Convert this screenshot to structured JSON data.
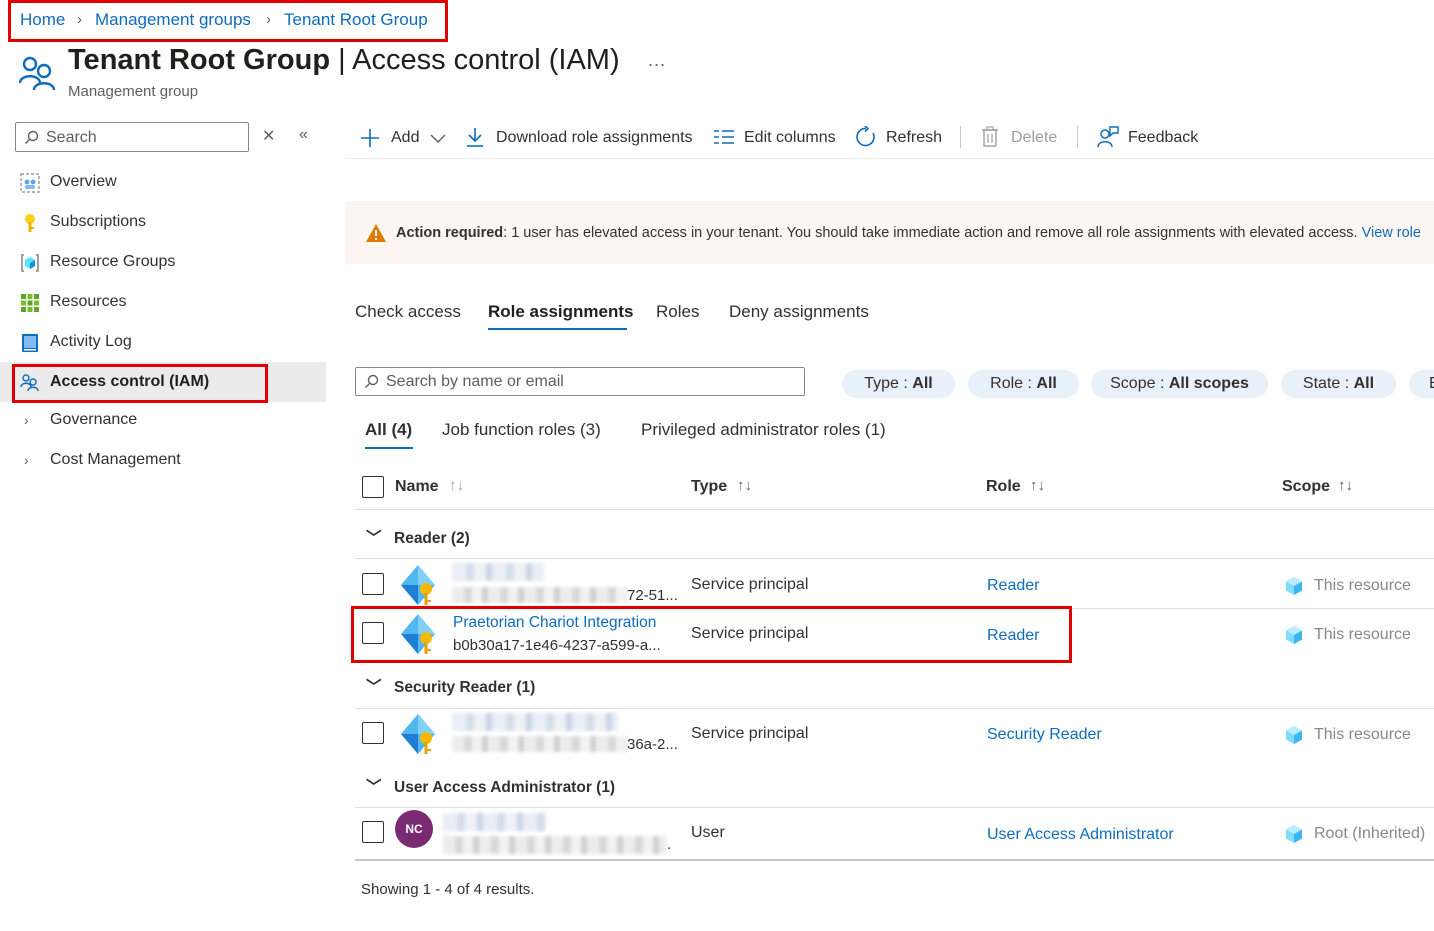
{
  "breadcrumb": [
    "Home",
    "Management groups",
    "Tenant Root Group"
  ],
  "header": {
    "title_bold": "Tenant Root Group",
    "title_rest": "Access control (IAM)",
    "subtitle": "Management group",
    "more": "..."
  },
  "sidebar": {
    "search_placeholder": "Search",
    "items": [
      {
        "label": "Overview"
      },
      {
        "label": "Subscriptions"
      },
      {
        "label": "Resource Groups"
      },
      {
        "label": "Resources"
      },
      {
        "label": "Activity Log"
      },
      {
        "label": "Access control (IAM)"
      },
      {
        "label": "Governance"
      },
      {
        "label": "Cost Management"
      }
    ]
  },
  "toolbar": {
    "add": "Add",
    "download": "Download role assignments",
    "edit_columns": "Edit columns",
    "refresh": "Refresh",
    "delete": "Delete",
    "feedback": "Feedback"
  },
  "banner": {
    "bold": "Action required",
    "text": ": 1 user has elevated access in your tenant. You should take immediate action and remove all role assignments with elevated access. ",
    "link": "View role"
  },
  "tabs": [
    "Check access",
    "Role assignments",
    "Roles",
    "Deny assignments"
  ],
  "search_placeholder": "Search by name or email",
  "filters": [
    {
      "key": "Type : ",
      "value": "All"
    },
    {
      "key": "Role : ",
      "value": "All"
    },
    {
      "key": "Scope : ",
      "value": "All scopes"
    },
    {
      "key": "State : ",
      "value": "All"
    },
    {
      "key": "E",
      "value": ""
    }
  ],
  "subtabs": [
    "All (4)",
    "Job function roles (3)",
    "Privileged administrator roles (1)"
  ],
  "columns": [
    "Name",
    "Type",
    "Role",
    "Scope"
  ],
  "sort_glyph": "↑↓",
  "groups": [
    {
      "label": "Reader (2)"
    },
    {
      "label": "Security Reader (1)"
    },
    {
      "label": "User Access Administrator (1)"
    }
  ],
  "rows": [
    {
      "name_tail": "72-51...",
      "type": "Service principal",
      "role": "Reader",
      "scope": "This resource"
    },
    {
      "name": "Praetorian Chariot Integration",
      "id": "b0b30a17-1e46-4237-a599-a...",
      "type": "Service principal",
      "role": "Reader",
      "scope": "This resource"
    },
    {
      "name_tail": "36a-2...",
      "type": "Service principal",
      "role": "Security Reader",
      "scope": "This resource"
    },
    {
      "avatar": "NC",
      "name_tail": ".",
      "type": "User",
      "role": "User Access Administrator",
      "scope": "Root (Inherited)"
    }
  ],
  "footer": "Showing 1 - 4 of 4 results."
}
